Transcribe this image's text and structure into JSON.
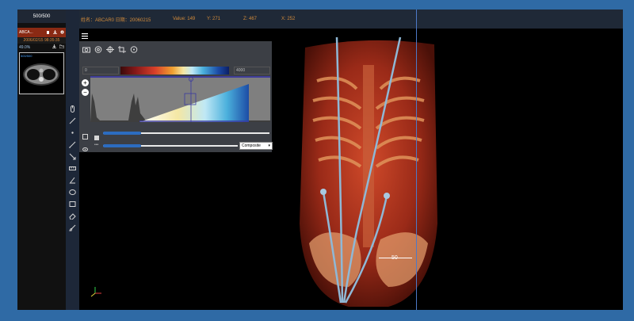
{
  "left_panel": {
    "image_count": "500/500",
    "series_name": "ABCA...",
    "series_date": "2006/02/15 98:35:35",
    "progress_text": "49.0%",
    "thumbnail_label": "500/500",
    "accent_color": "#8a2a14"
  },
  "info_bar": {
    "patient": "姓名：ABCAR0 日期：20060215",
    "value": "Value: 149",
    "y": "Y: 271",
    "z": "Z: 467",
    "x": "X: 252",
    "text_color": "#d18a3a"
  },
  "tf_panel": {
    "icons": [
      "camera-icon",
      "aperture-icon",
      "crosshair-icon",
      "crop-icon",
      "reset-icon"
    ],
    "min_value": "0",
    "max_value": "4000",
    "zoom_in_label": "+",
    "zoom_out_label": "−",
    "opacity_slider_value": 0.23,
    "sample_slider_value": 0.28,
    "render_mode": "Composite"
  },
  "tools": [
    "mouse-icon",
    "line-icon",
    "dot-icon",
    "line-measure-icon",
    "arrow-icon",
    "ruler-icon",
    "angle-icon",
    "ellipse-icon",
    "rectangle-icon",
    "eraser-icon",
    "brush-icon"
  ],
  "viewport": {
    "scale_label": "50"
  }
}
